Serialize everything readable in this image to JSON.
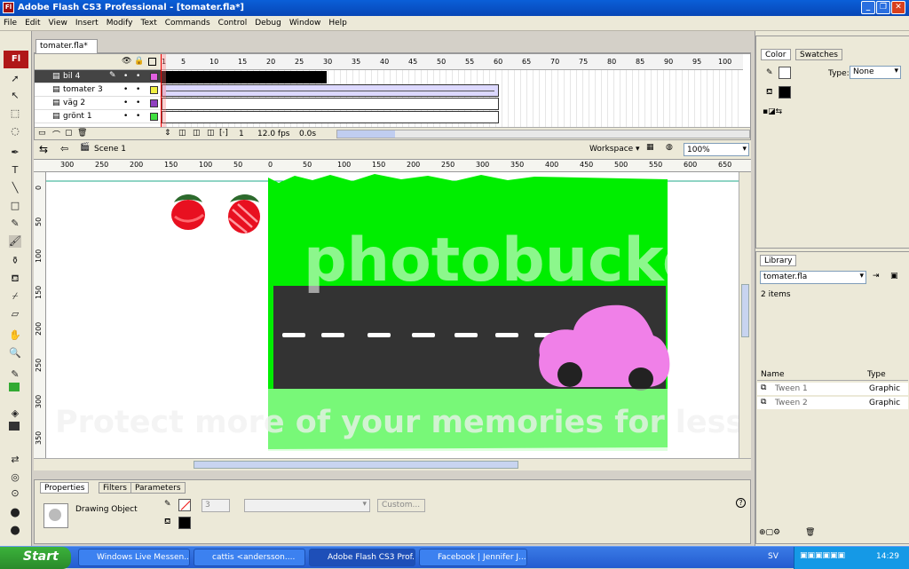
{
  "window": {
    "title": "Adobe Flash CS3 Professional - [tomater.fla*]",
    "app_icon": "Fl"
  },
  "menu": [
    "File",
    "Edit",
    "View",
    "Insert",
    "Modify",
    "Text",
    "Commands",
    "Control",
    "Debug",
    "Window",
    "Help"
  ],
  "toolbox": {
    "logo": "Fl"
  },
  "document": {
    "tab": "tomater.fla*"
  },
  "timeline": {
    "frame_numbers": [
      "1",
      "5",
      "10",
      "15",
      "20",
      "25",
      "30",
      "35",
      "40",
      "45",
      "50",
      "55",
      "60",
      "65",
      "70",
      "75",
      "80",
      "85",
      "90",
      "95",
      "100"
    ],
    "layers": [
      {
        "name": "bil 4",
        "color": "#e060e0"
      },
      {
        "name": "tomater 3",
        "color": "#f0f040"
      },
      {
        "name": "väg 2",
        "color": "#9040c0"
      },
      {
        "name": "grönt 1",
        "color": "#40e040"
      }
    ],
    "current_frame": "1",
    "fps": "12.0 fps",
    "time": "0.0s"
  },
  "edit_bar": {
    "scene": "Scene 1",
    "workspace": "Workspace ▾",
    "zoom": "100%"
  },
  "rulers": {
    "horizontal": [
      "300",
      "250",
      "200",
      "150",
      "100",
      "50",
      "0",
      "50",
      "100",
      "150",
      "200",
      "250",
      "300",
      "350",
      "400",
      "450",
      "500",
      "550",
      "600",
      "650"
    ],
    "vertical": [
      "0",
      "50",
      "100",
      "150",
      "200",
      "250",
      "300",
      "350"
    ]
  },
  "watermark": {
    "brand": "photobucket",
    "tagline": "Protect more of your memories for less!"
  },
  "properties": {
    "tabs": [
      "Properties",
      "Filters",
      "Parameters"
    ],
    "object_type": "Drawing Object",
    "stroke_height": "3",
    "custom_button": "Custom..."
  },
  "color_panel": {
    "tabs": [
      "Color",
      "Swatches"
    ],
    "type_label": "Type:",
    "type_value": "None"
  },
  "library": {
    "tab": "Library",
    "file": "tomater.fla",
    "count": "2 items",
    "columns": [
      "Name",
      "Type"
    ],
    "items": [
      {
        "name": "Tween 1",
        "type": "Graphic"
      },
      {
        "name": "Tween 2",
        "type": "Graphic"
      }
    ]
  },
  "taskbar": {
    "start": "Start",
    "tasks": [
      "Windows Live Messen...",
      "cattis <andersson....",
      "Adobe Flash CS3 Prof...",
      "Facebook | Jennifer J..."
    ],
    "tray": {
      "lang": "SV",
      "clock": "14:29"
    }
  },
  "colors": {
    "stage_green": "#00f000",
    "road": "#333333",
    "car": "#f080e8",
    "tomato": "#e81020"
  }
}
